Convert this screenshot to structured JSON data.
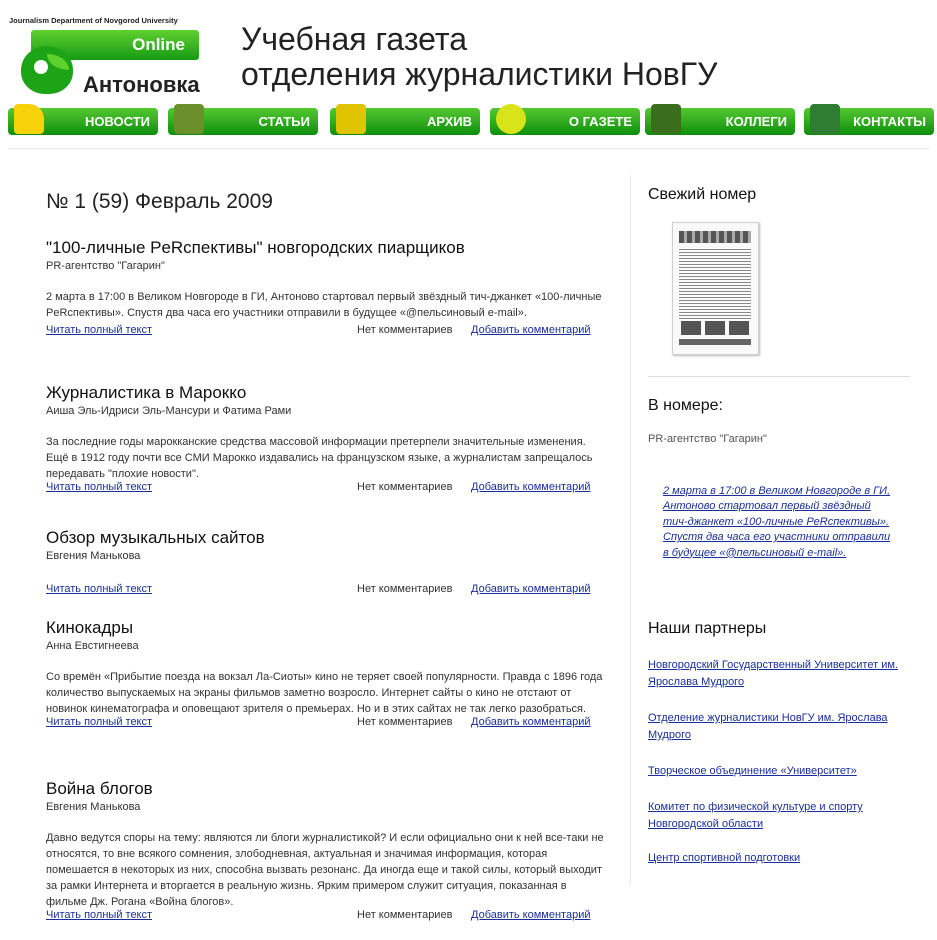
{
  "header": {
    "logo": {
      "dept": "Journalism Department of Novgorod University",
      "online": "Online",
      "brand": "Антоновка"
    },
    "title_line1": "Учебная газета",
    "title_line2": "отделения журналистики НовГУ"
  },
  "nav": [
    {
      "label": "НОВОСТИ",
      "icon": "bell-icon",
      "color": "#f5d20a"
    },
    {
      "label": "СТАТЬИ",
      "icon": "books-abc-icon",
      "color": "#6b8f2a"
    },
    {
      "label": "АРХИВ",
      "icon": "archive-box-icon",
      "color": "#e0c400"
    },
    {
      "label": "О ГАЗЕТЕ",
      "icon": "apple-icon",
      "color": "#d8e31a"
    },
    {
      "label": "КОЛЛЕГИ",
      "icon": "star-emblem-icon",
      "color": "#3b6e1c"
    },
    {
      "label": "КОНТАКТЫ",
      "icon": "contact-card-icon",
      "color": "#2e7d32"
    }
  ],
  "main": {
    "issue_title": "№ 1 (59) Февраль 2009",
    "read_more": "Читать полный текст",
    "no_comments": "Нет комментариев",
    "add_comment": "Добавить комментарий",
    "articles": [
      {
        "title": "\"100-личные PeRcпективы\" новгородских пиарщиков",
        "author": "PR-агентство \"Гагарин\"",
        "text": "2 марта в 17:00 в Великом Новгороде в ГИ, Антоново стартовал первый звёздный тич-джанкет «100-личные PeRcпективы». Спустя два часа его участники отправили в будущее «@пельсиновый e-mail»."
      },
      {
        "title": "Журналистика в Марокко",
        "author": "Аиша Эль-Идриси Эль-Мансури и Фатима Рами",
        "text": "За последние годы марокканские средства массовой информации претерпели значительные изменения. Ещё в 1912 году почти все СМИ Марокко издавались на французском языке, а журналистам запрещалось передавать \"плохие новости\"."
      },
      {
        "title": "Обзор музыкальных сайтов",
        "author": "Евгения Манькова",
        "text": ""
      },
      {
        "title": "Кинокадры",
        "author": "Анна Евстигнеева",
        "text": "Со времён «Прибытие поезда на вокзал Ла-Сиоты» кино не теряет своей популярности. Правда с 1896 года количество выпускаемых на экраны фильмов заметно возросло. Интернет сайты о кино не отстают от новинок кинематографа и оповещают зрителя о премьерах. Но и в этих сайтах не так легко разобраться."
      },
      {
        "title": "Война блогов",
        "author": "Евгения Манькова",
        "text": "Давно ведутся споры на тему: являются ли блоги журналистикой? И если официально они к ней все-таки не относятся, то вне всякого сомнения, злободневная, актуальная и значимая информация, которая помешается в некоторых из них, способна вызвать резонанс. Да иногда еще и такой силы, который выходит за рамки Интернета и вторгается в реальную жизнь. Ярким примером служит ситуация, показанная в фильме Дж. Рогана «Война блогов»."
      }
    ]
  },
  "sidebar": {
    "fresh_issue": "Свежий номер",
    "in_issue": "В номере:",
    "in_issue_source": "PR-агентство \"Гагарин\"",
    "in_issue_teaser": "2 марта в 17:00 в Великом Новгороде в ГИ, Антоново стартовал первый звёздный тич-джанкет «100-личные PeRcпективы». Спустя два часа его участники отправили в будущее «@пельсиновый e-mail».",
    "partners_title": "Наши партнеры",
    "partners": [
      "Новгородский Государственный Университет им. Ярослава Мудрого",
      "Отделение журналистики НовГУ им. Ярослава Мудрого",
      "Творческое объединение «Университет»",
      "Комитет по физической культуре и спорту Новгородской области",
      "Центр спортивной подготовки"
    ]
  }
}
